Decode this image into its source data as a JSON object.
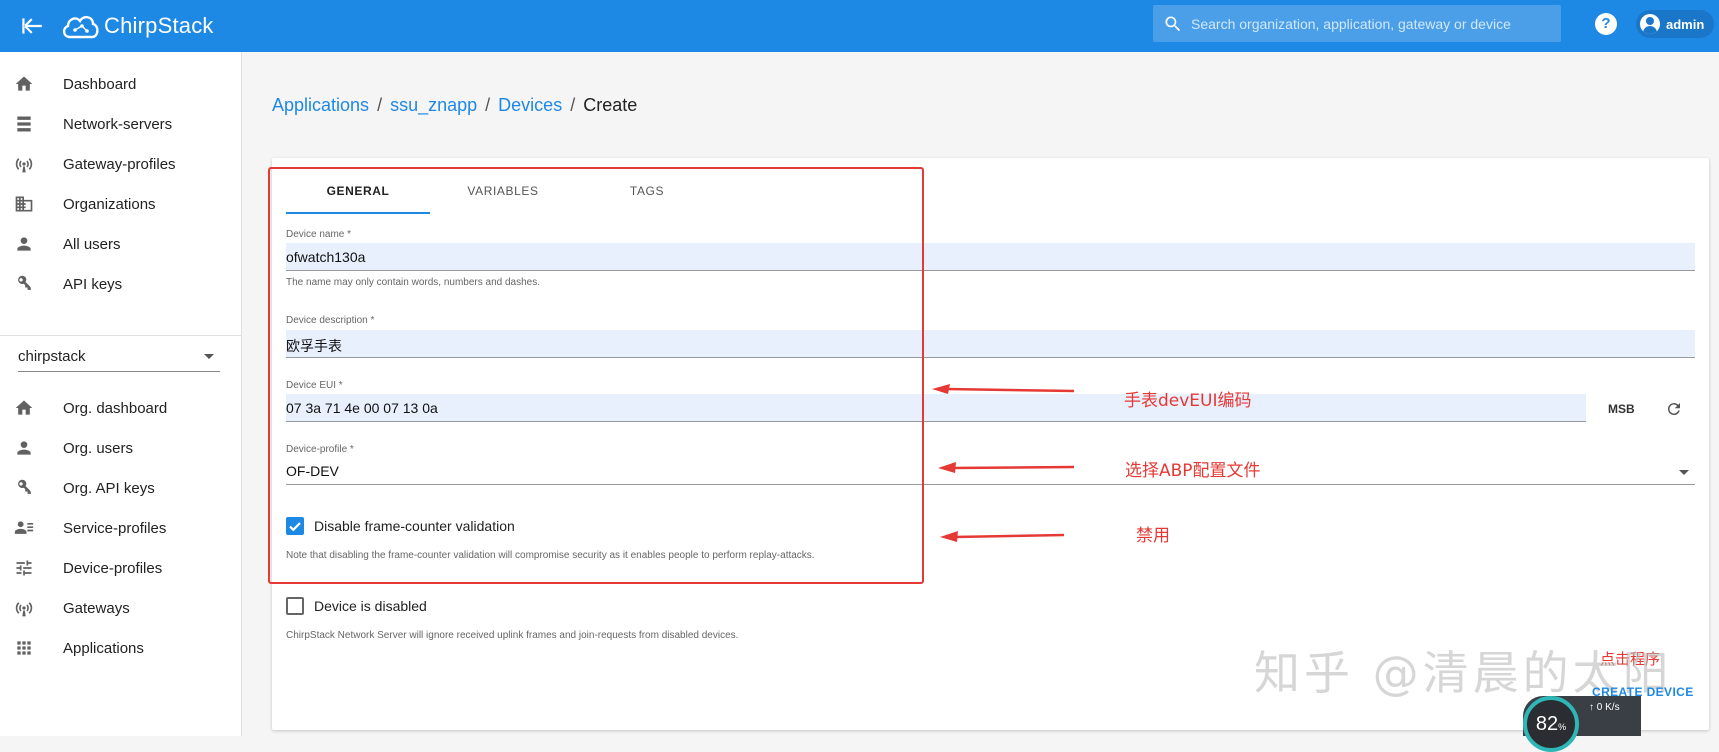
{
  "topbar": {
    "brand": "ChirpStack",
    "search_placeholder": "Search organization, application, gateway or device",
    "help": "?",
    "user": "admin"
  },
  "sidebar": {
    "global_items": [
      {
        "label": "Dashboard",
        "icon": "home-icon"
      },
      {
        "label": "Network-servers",
        "icon": "server-icon"
      },
      {
        "label": "Gateway-profiles",
        "icon": "radio-tower-icon"
      },
      {
        "label": "Organizations",
        "icon": "building-icon"
      },
      {
        "label": "All users",
        "icon": "person-icon"
      },
      {
        "label": "API keys",
        "icon": "key-icon"
      }
    ],
    "org_selected": "chirpstack",
    "org_items": [
      {
        "label": "Org. dashboard",
        "icon": "home-icon"
      },
      {
        "label": "Org. users",
        "icon": "person-icon"
      },
      {
        "label": "Org. API keys",
        "icon": "key-icon"
      },
      {
        "label": "Service-profiles",
        "icon": "account-details-icon"
      },
      {
        "label": "Device-profiles",
        "icon": "tune-icon"
      },
      {
        "label": "Gateways",
        "icon": "radio-tower-icon"
      },
      {
        "label": "Applications",
        "icon": "apps-grid-icon"
      }
    ]
  },
  "breadcrumb": {
    "applications": "Applications",
    "app": "ssu_znapp",
    "devices": "Devices",
    "current": "Create",
    "sep": "/"
  },
  "tabs": [
    "GENERAL",
    "VARIABLES",
    "TAGS"
  ],
  "form": {
    "device_name_label": "Device name *",
    "device_name_value": "ofwatch130a",
    "device_name_help": "The name may only contain words, numbers and dashes.",
    "description_label": "Device description *",
    "description_value": "欧孚手表",
    "eui_label": "Device EUI *",
    "eui_value": "07 3a 71 4e 00 07 13 0a",
    "eui_byte_order": "MSB",
    "profile_label": "Device-profile *",
    "profile_value": "OF-DEV",
    "fcnt_label": "Disable frame-counter validation",
    "fcnt_checked": true,
    "fcnt_help": "Note that disabling the frame-counter validation will compromise security as it enables people to perform replay-attacks.",
    "disabled_label": "Device is disabled",
    "disabled_checked": false,
    "disabled_help": "ChirpStack Network Server will ignore received uplink frames and join-requests from disabled devices.",
    "submit": "CREATE DEVICE"
  },
  "annotations": {
    "eui": "手表devEUI编码",
    "profile": "选择ABP配置文件",
    "disable": "禁用",
    "click": "点击程序"
  },
  "watermark": "知乎 @清晨的太阳",
  "speed_widget": {
    "percent": "82",
    "unit": "%",
    "up": "0",
    "up_unit": "K/s"
  },
  "colors": {
    "primary": "#1e88e5",
    "annotation": "#e53935",
    "input_bg": "#e8f0fe"
  }
}
